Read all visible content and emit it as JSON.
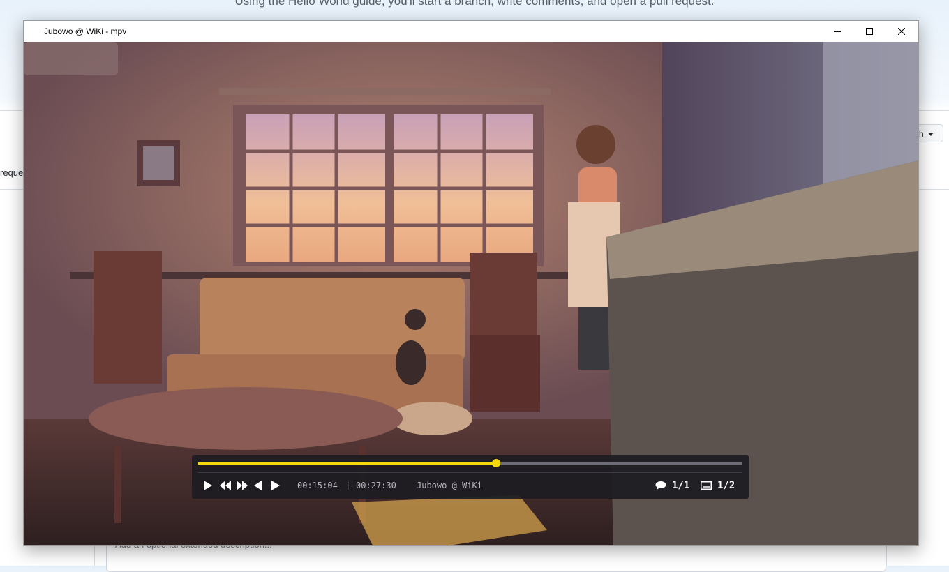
{
  "background_page": {
    "heading": "Using the Hello World guide, you'll start a branch, write comments, and open a pull request.",
    "side_text": "reque",
    "branch_button": "ch",
    "description_placeholder": "Add an optional extended description..."
  },
  "window": {
    "title": "Jubowo @ WiKi - mpv",
    "controls": [
      "minimize-icon",
      "maximize-icon",
      "close-icon"
    ]
  },
  "player": {
    "progress": 0.5475,
    "elapsed": "00:15:04",
    "separator": "|",
    "duration": "00:27:30",
    "media_title": "Jubowo @ WiKi",
    "chapter_track": "1/1",
    "subtitle_track": "1/2",
    "colors": {
      "accent": "#f5d90a",
      "panel": "#1c1c22",
      "text": "#b7b7bf"
    }
  }
}
